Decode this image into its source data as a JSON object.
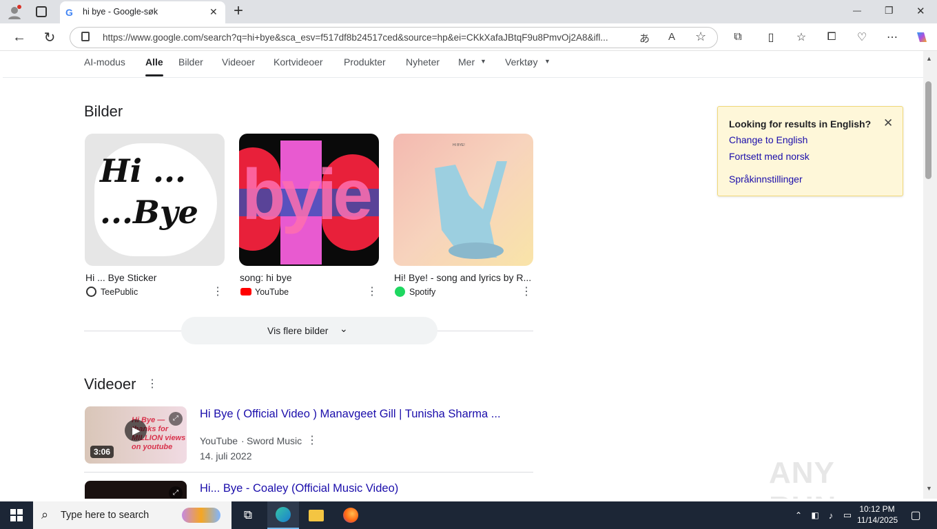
{
  "browser": {
    "tab_title": "hi bye - Google-søk",
    "new_tab": "+",
    "url": "https://www.google.com/search?q=hi+bye&sca_esv=f517df8b24517ced&source=hp&ei=CKkXafaJBtqF9u8PmvOj2A8&ifl...",
    "window_controls": {
      "minimize": "—",
      "restore": "❐",
      "close": "✕"
    }
  },
  "nav": {
    "tabs": [
      "AI-modus",
      "Alle",
      "Bilder",
      "Videoer",
      "Kortvideoer",
      "Produkter",
      "Nyheter",
      "Mer",
      "Verktøy"
    ],
    "active": "Alle"
  },
  "images": {
    "heading": "Bilder",
    "items": [
      {
        "caption": "Hi ... Bye Sticker",
        "source": "TeePublic",
        "thumb_text": "Hi ... ...Bye"
      },
      {
        "caption": "song: hi bye",
        "source": "YouTube",
        "thumb_text": "byie"
      },
      {
        "caption": "Hi! Bye! - song and lyrics by R...",
        "source": "Spotify",
        "thumb_text": "HI BYE!"
      }
    ],
    "more_button": "Vis flere bilder"
  },
  "videos": {
    "heading": "Videoer",
    "items": [
      {
        "title": "Hi Bye ( Official Video ) Manavgeet Gill | Tunisha Sharma ...",
        "platform": "YouTube",
        "channel": "Sword Music",
        "date": "14. juli 2022",
        "duration": "3:06",
        "thumb_text": "Hi Bye — thanks for MILLION views on youtube"
      },
      {
        "title": "Hi... Bye - Coaley (Official Music Video)"
      }
    ]
  },
  "language_prompt": {
    "title": "Looking for results in English?",
    "change": "Change to English",
    "continue": "Fortsett med norsk",
    "settings": "Språkinnstillinger"
  },
  "watermark": "ANY RUN",
  "taskbar": {
    "search_placeholder": "Type here to search",
    "time": "10:12 PM",
    "date": "11/14/2025"
  },
  "colors": {
    "link": "#1a0dab",
    "notice_bg": "#fef7d9",
    "taskbar": "#1c2636"
  }
}
